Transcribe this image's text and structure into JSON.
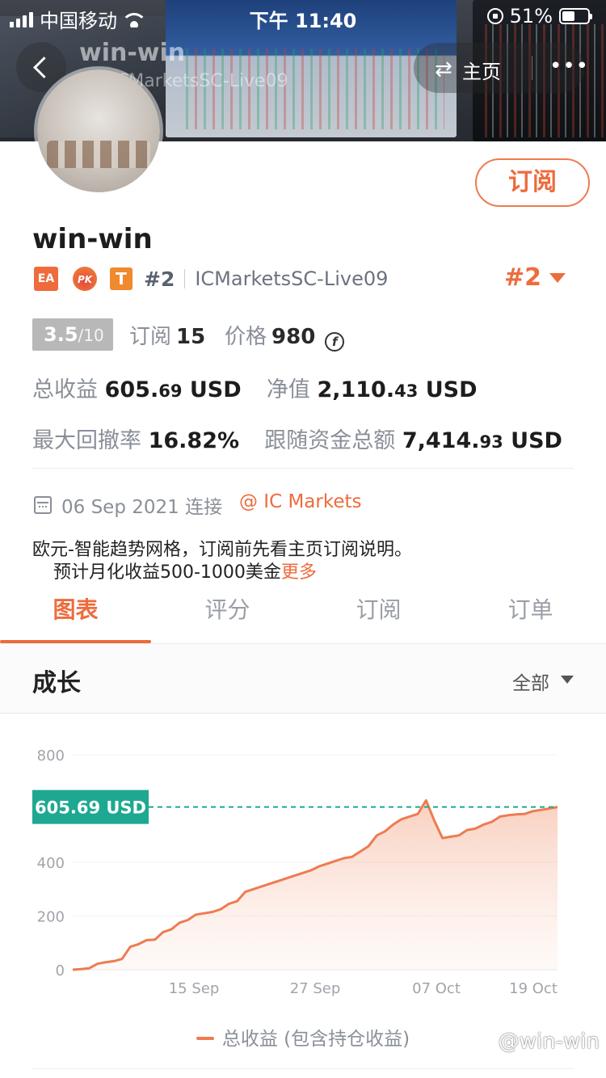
{
  "status_bar": {
    "carrier": "中国移动",
    "time": "下午 11:40",
    "battery": "51%"
  },
  "nav": {
    "title": "win-win",
    "subtitle": "#2 ICMarketsSC-Live09",
    "home_label": "主页",
    "more": "•••"
  },
  "profile": {
    "subscribe_label": "订阅",
    "name": "win-win",
    "badges": {
      "ea": "EA",
      "pk": "PK",
      "t": "T"
    },
    "rank_small": "#2",
    "server": "ICMarketsSC-Live09",
    "rank_big": "#2",
    "score_value": "3.5",
    "score_max": "/10",
    "subscribers_label": "订阅",
    "subscribers_value": "15",
    "price_label": "价格",
    "price_value": "980",
    "price_icon": "f"
  },
  "metrics": {
    "total_profit_label": "总收益",
    "total_profit_int": "605.",
    "total_profit_dec": "69",
    "total_profit_unit": "USD",
    "equity_label": "净值",
    "equity_int": "2,110.",
    "equity_dec": "43",
    "equity_unit": "USD",
    "drawdown_label": "最大回撤率",
    "drawdown_value": "16.82%",
    "follow_label": "跟随资金总额",
    "follow_int": "7,414.",
    "follow_dec": "93",
    "follow_unit": "USD"
  },
  "connect": {
    "date": "06 Sep 2021 连接",
    "broker": "@ IC Markets"
  },
  "description": {
    "line1": "欧元-智能趋势网格，订阅前先看主页订阅说明。",
    "line2": "预计月化收益500-1000美金",
    "more": "更多"
  },
  "tabs": [
    "图表",
    "评分",
    "订阅",
    "订单"
  ],
  "section": {
    "title": "成长",
    "range": "全部"
  },
  "chart_data": {
    "type": "area",
    "x_ticks": [
      "15 Sep",
      "27 Sep",
      "07 Oct",
      "19 Oct"
    ],
    "ylim": [
      0,
      800
    ],
    "y_ticks": [
      "0",
      "200",
      "400",
      "800"
    ],
    "current_label": "605.69 USD",
    "current_value": 605.69,
    "legend": "总收益 (包含持仓收益)",
    "series": [
      {
        "values": [
          0,
          2,
          5,
          22,
          28,
          32,
          40,
          85,
          95,
          110,
          112,
          140,
          150,
          175,
          185,
          205,
          210,
          215,
          225,
          245,
          255,
          290,
          300,
          310,
          320,
          330,
          340,
          350,
          360,
          370,
          385,
          395,
          405,
          415,
          420,
          440,
          460,
          500,
          515,
          540,
          560,
          570,
          580,
          630,
          555,
          490,
          495,
          500,
          520,
          525,
          540,
          550,
          570,
          575,
          578,
          580,
          590,
          595,
          600,
          605.69
        ]
      }
    ],
    "grid": true
  },
  "watermark": "@win-win",
  "colors": {
    "accent": "#ee6b3c",
    "teal": "#1fa891"
  }
}
